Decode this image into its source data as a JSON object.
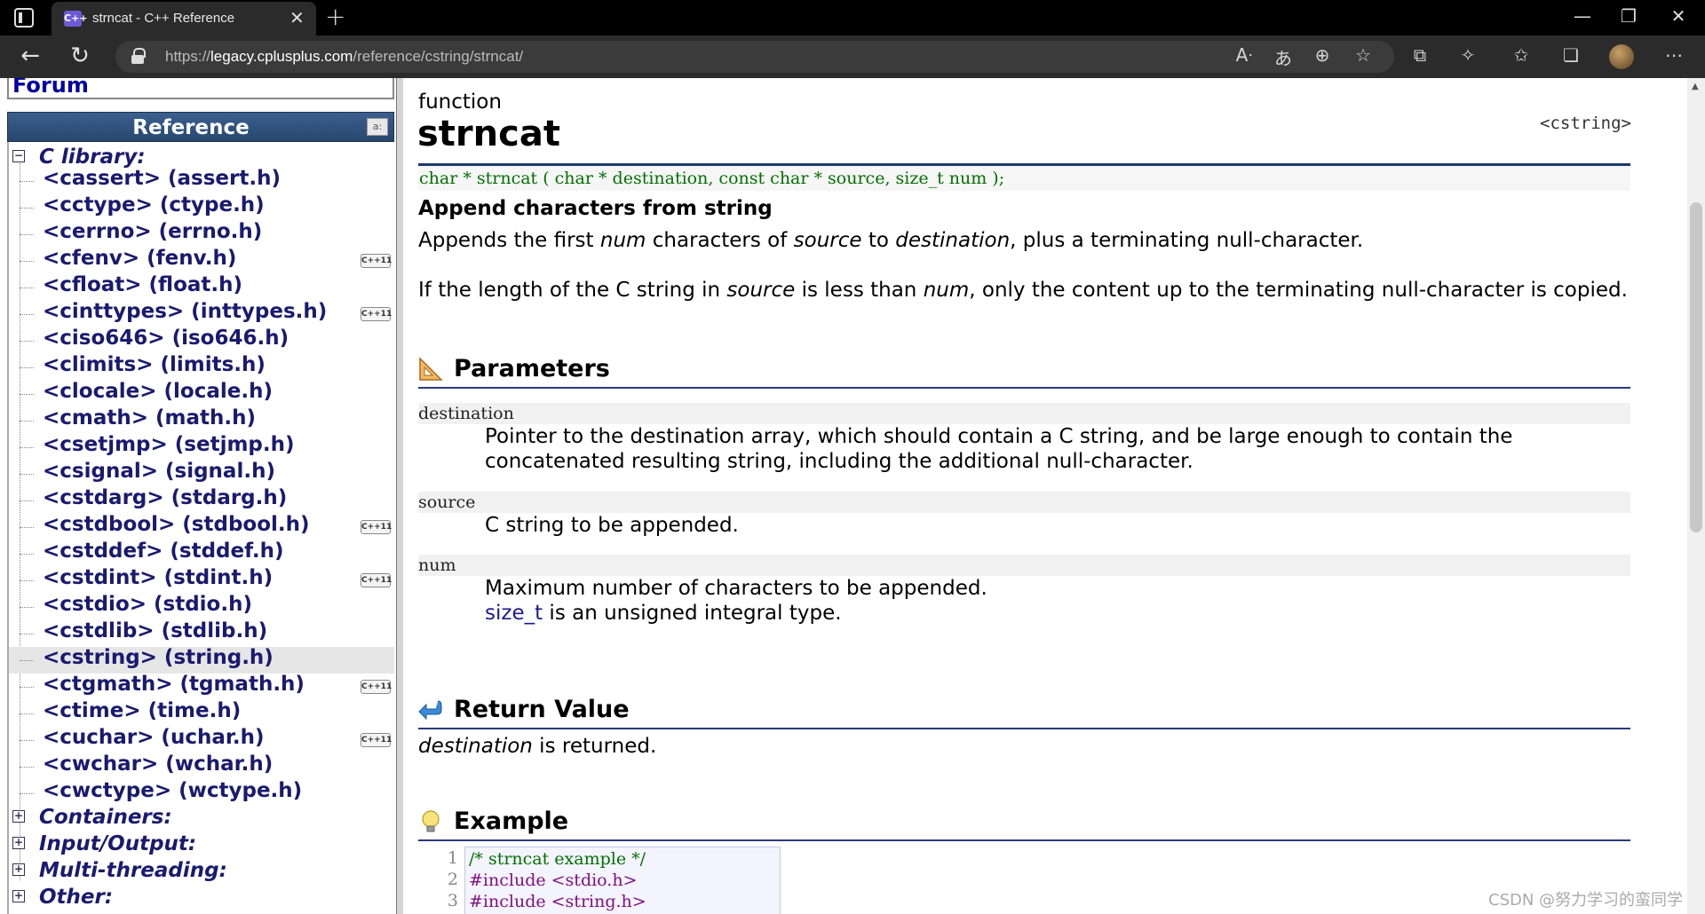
{
  "browser": {
    "tab_title": "strncat - C++ Reference",
    "favicon_text": "C++",
    "url_prefix": "https://",
    "url_host": "legacy.cplusplus.com",
    "url_path": "/reference/cstring/strncat/"
  },
  "sidebar": {
    "forum_label": "Forum",
    "reference_title": "Reference",
    "c_library_label": "C library:",
    "items": [
      {
        "label": "<cassert> (assert.h)",
        "cpp11": false
      },
      {
        "label": "<cctype> (ctype.h)",
        "cpp11": false
      },
      {
        "label": "<cerrno> (errno.h)",
        "cpp11": false
      },
      {
        "label": "<cfenv> (fenv.h)",
        "cpp11": true
      },
      {
        "label": "<cfloat> (float.h)",
        "cpp11": false
      },
      {
        "label": "<cinttypes> (inttypes.h)",
        "cpp11": true
      },
      {
        "label": "<ciso646> (iso646.h)",
        "cpp11": false
      },
      {
        "label": "<climits> (limits.h)",
        "cpp11": false
      },
      {
        "label": "<clocale> (locale.h)",
        "cpp11": false
      },
      {
        "label": "<cmath> (math.h)",
        "cpp11": false
      },
      {
        "label": "<csetjmp> (setjmp.h)",
        "cpp11": false
      },
      {
        "label": "<csignal> (signal.h)",
        "cpp11": false
      },
      {
        "label": "<cstdarg> (stdarg.h)",
        "cpp11": false
      },
      {
        "label": "<cstdbool> (stdbool.h)",
        "cpp11": true
      },
      {
        "label": "<cstddef> (stddef.h)",
        "cpp11": false
      },
      {
        "label": "<cstdint> (stdint.h)",
        "cpp11": true
      },
      {
        "label": "<cstdio> (stdio.h)",
        "cpp11": false
      },
      {
        "label": "<cstdlib> (stdlib.h)",
        "cpp11": false
      },
      {
        "label": "<cstring> (string.h)",
        "cpp11": false,
        "selected": true
      },
      {
        "label": "<ctgmath> (tgmath.h)",
        "cpp11": true
      },
      {
        "label": "<ctime> (time.h)",
        "cpp11": false
      },
      {
        "label": "<cuchar> (uchar.h)",
        "cpp11": true
      },
      {
        "label": "<cwchar> (wchar.h)",
        "cpp11": false
      },
      {
        "label": "<cwctype> (wctype.h)",
        "cpp11": false
      }
    ],
    "cpp11_badge": "C++11",
    "other_categories": [
      "Containers:",
      "Input/Output:",
      "Multi-threading:",
      "Other:"
    ]
  },
  "main": {
    "kind": "function",
    "name": "strncat",
    "header": "<cstring>",
    "prototype": "char * strncat ( char * destination, const char * source, size_t num );",
    "summary": "Append characters from string",
    "desc1": {
      "a": "Appends the first ",
      "b": "num",
      "c": " characters of ",
      "d": "source",
      "e": " to ",
      "f": "destination",
      "g": ", plus a terminating null-character."
    },
    "desc2": {
      "a": "If the length of the C string in ",
      "b": "source",
      "c": " is less than ",
      "d": "num",
      "e": ", only the content up to the terminating null-character is copied."
    },
    "parameters_title": "Parameters",
    "params": [
      {
        "name": "destination",
        "lines": [
          "Pointer to the destination array, which should contain a C string, and be large enough to contain the",
          "concatenated resulting string, including the additional null-character."
        ]
      },
      {
        "name": "source",
        "lines": [
          "C string to be appended."
        ]
      },
      {
        "name": "num",
        "lines": [
          "Maximum number of characters to be appended."
        ],
        "link": "size_t",
        "link_rest": " is an unsigned integral type."
      }
    ],
    "return_title": "Return Value",
    "return": {
      "a": "destination",
      "b": " is returned."
    },
    "example_title": "Example",
    "code": [
      {
        "n": "1",
        "text": "/* strncat example */",
        "kind": "cmt"
      },
      {
        "n": "2",
        "text": "#include <stdio.h>",
        "kind": "pp"
      },
      {
        "n": "3",
        "text": "#include <string.h>",
        "kind": "pp"
      }
    ]
  },
  "watermark": "CSDN @努力学习的蛮同学",
  "colors": {
    "accent": "#1a1a70",
    "proto": "#007000",
    "header_bar": "#27476f"
  }
}
